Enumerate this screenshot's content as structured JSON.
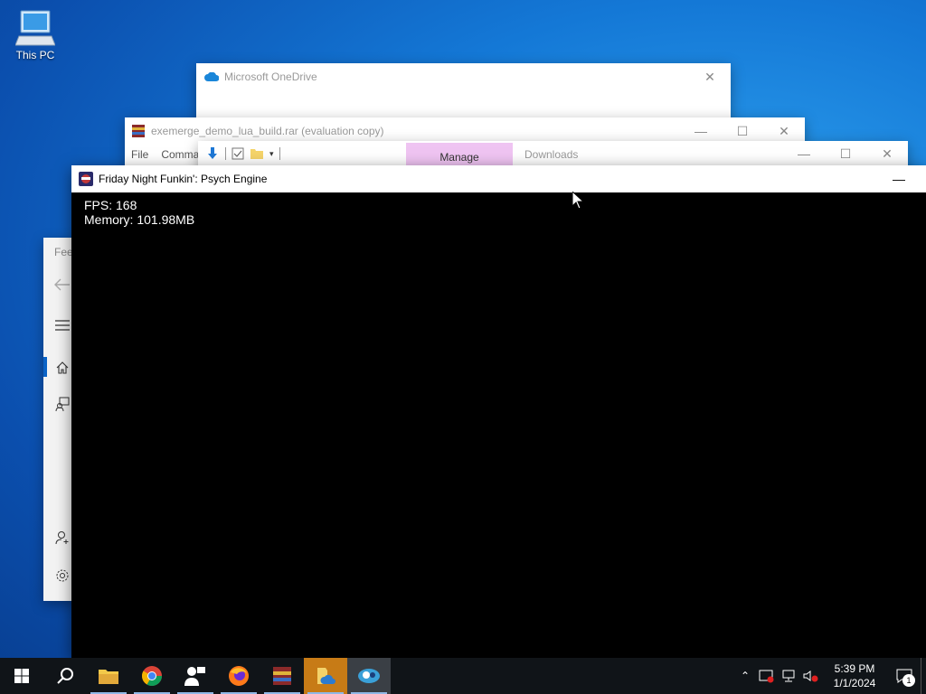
{
  "desktop": {
    "this_pc_label": "This PC"
  },
  "onedrive": {
    "title": "Microsoft OneDrive"
  },
  "winrar": {
    "title": "exemerge_demo_lua_build.rar (evaluation copy)",
    "menu": [
      "File",
      "Comma"
    ]
  },
  "explorer": {
    "manage_tab": "Manage",
    "downloads_tab": "Downloads"
  },
  "settings": {
    "title_partial": "Fee"
  },
  "game": {
    "title": "Friday Night Funkin': Psych Engine",
    "fps_line": "FPS: 168",
    "memory_line": "Memory: 101.98MB"
  },
  "taskbar": {
    "apps": [
      "file-explorer-icon",
      "chrome-icon",
      "people-icon",
      "firefox-icon",
      "winrar-icon",
      "onedrive-folder-icon",
      "psych-engine-icon"
    ],
    "clock_time": "5:39 PM",
    "clock_date": "1/1/2024",
    "notification_count": "1"
  },
  "colors": {
    "accent": "#0a63c7",
    "manage_tab": "#efc4f2",
    "taskbar": "#101418"
  }
}
